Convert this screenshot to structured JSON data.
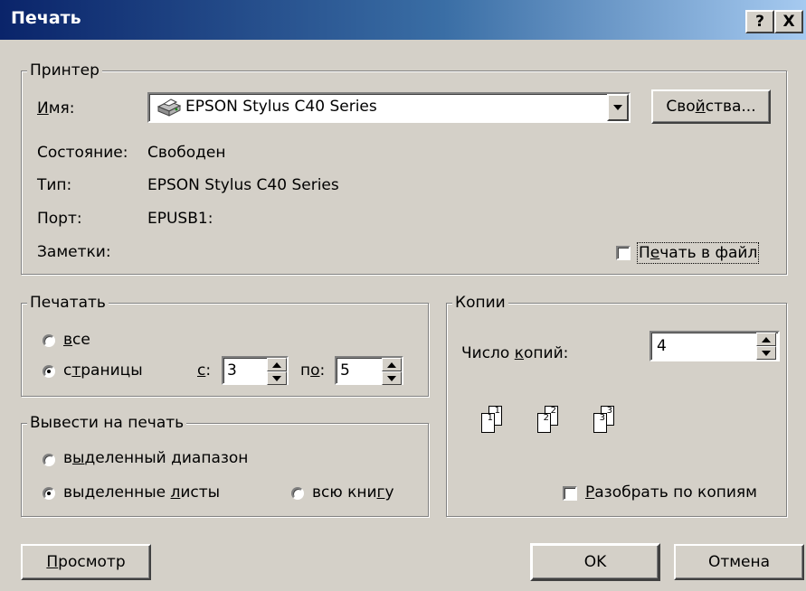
{
  "window": {
    "title": "Печать",
    "help_label": "?",
    "close_label": "X"
  },
  "printer": {
    "legend": "Принтер",
    "name_label_pre": "",
    "name_label_u": "И",
    "name_label_post": "мя:",
    "name_value": "EPSON Stylus C40 Series",
    "properties_pre": "Сво",
    "properties_u": "й",
    "properties_post": "ства...",
    "status_label": "Состояние:",
    "status_value": "Свободен",
    "type_label": "Тип:",
    "type_value": "EPSON Stylus C40 Series",
    "port_label": "Порт:",
    "port_value": "EPUSB1:",
    "notes_label": "Заметки:",
    "print_to_file_pre": "П",
    "print_to_file_u": "е",
    "print_to_file_post": "чать в файл"
  },
  "print_range": {
    "legend": "Печатать",
    "all_u": "в",
    "all_post": "се",
    "pages_pre": "с",
    "pages_u": "т",
    "pages_post": "раницы",
    "from_u": "с",
    "from_post": ":",
    "from_value": "3",
    "to_pre": "п",
    "to_u": "о",
    "to_post": ":",
    "to_value": "5"
  },
  "copies": {
    "legend": "Копии",
    "count_pre": "Число ",
    "count_u": "к",
    "count_post": "опий:",
    "count_value": "4",
    "collate_u": "Р",
    "collate_post": "азобрать по копиям",
    "pages": [
      {
        "back": "1",
        "front": "1"
      },
      {
        "back": "2",
        "front": "2"
      },
      {
        "back": "3",
        "front": "3"
      }
    ]
  },
  "print_what": {
    "legend": "Вывести на печать",
    "selection_pre": "в",
    "selection_u": "ы",
    "selection_post": "деленный диапазон",
    "sheets_pre": "выделенные ",
    "sheets_u": "л",
    "sheets_post": "исты",
    "workbook_pre": "всю кни",
    "workbook_u": "г",
    "workbook_post": "у"
  },
  "footer": {
    "preview_u": "П",
    "preview_post": "росмотр",
    "ok_label": "OK",
    "cancel_label": "Отмена"
  }
}
